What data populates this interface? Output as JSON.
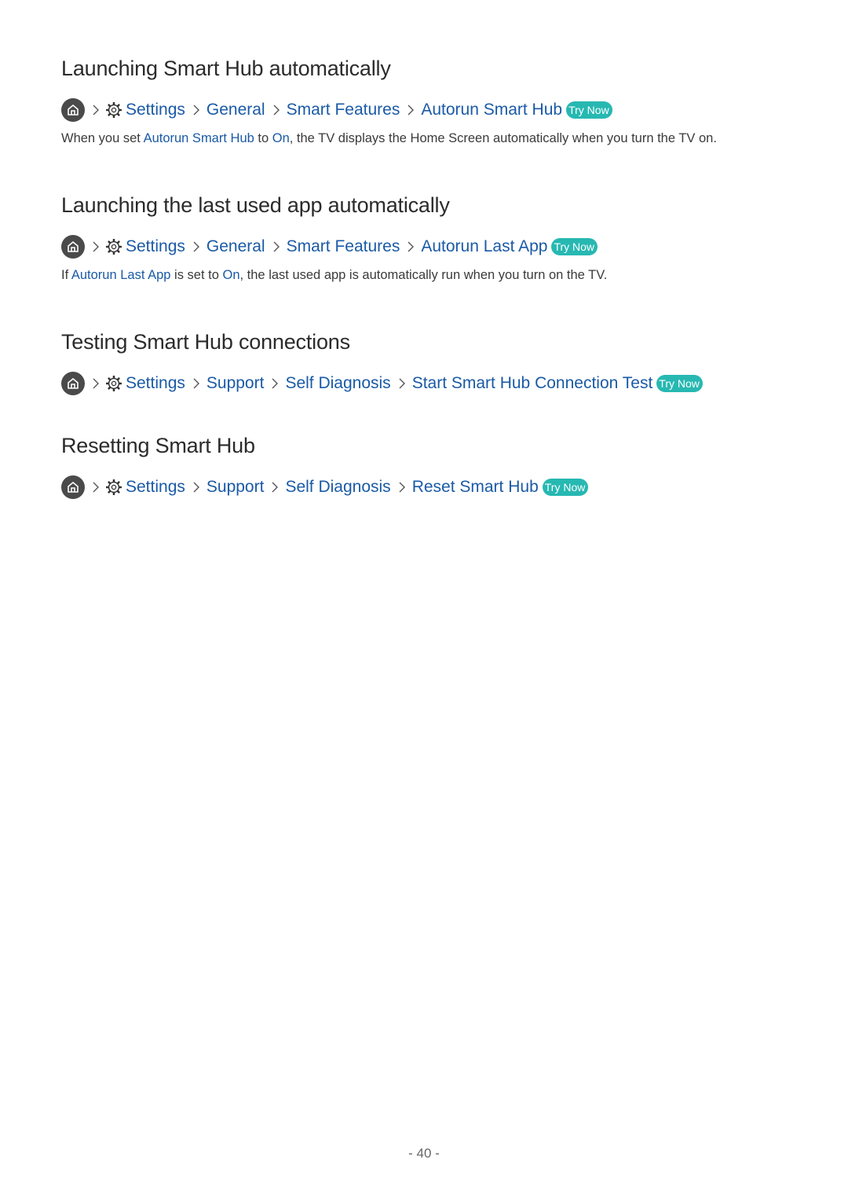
{
  "sections": [
    {
      "heading": "Launching Smart Hub automatically",
      "path": [
        "Settings",
        "General",
        "Smart Features",
        "Autorun Smart Hub"
      ],
      "try_now": "Try Now",
      "body": [
        {
          "text": "When you set ",
          "hl": false
        },
        {
          "text": "Autorun Smart Hub",
          "hl": true
        },
        {
          "text": " to ",
          "hl": false
        },
        {
          "text": "On",
          "hl": true
        },
        {
          "text": ", the TV displays the Home Screen automatically when you turn the TV on.",
          "hl": false
        }
      ]
    },
    {
      "heading": "Launching the last used app automatically",
      "path": [
        "Settings",
        "General",
        "Smart Features",
        "Autorun Last App"
      ],
      "try_now": "Try Now",
      "body": [
        {
          "text": "If ",
          "hl": false
        },
        {
          "text": "Autorun Last App",
          "hl": true
        },
        {
          "text": " is set to ",
          "hl": false
        },
        {
          "text": "On",
          "hl": true
        },
        {
          "text": ", the last used app is automatically run when you turn on the TV.",
          "hl": false
        }
      ]
    },
    {
      "heading": "Testing Smart Hub connections",
      "path": [
        "Settings",
        "Support",
        "Self Diagnosis",
        "Start Smart Hub Connection Test"
      ],
      "try_now": "Try Now",
      "body": []
    },
    {
      "heading": "Resetting Smart Hub",
      "path": [
        "Settings",
        "Support",
        "Self Diagnosis",
        "Reset Smart Hub"
      ],
      "try_now": "Try Now",
      "body": []
    }
  ],
  "icons": {
    "home": "home-icon",
    "settings": "gear-icon",
    "separator": "chevron-right-icon"
  },
  "colors": {
    "link": "#1a5aa6",
    "try_now_bg": "#27b8b2",
    "heading": "#2b2b2b"
  },
  "page_number": "- 40 -"
}
